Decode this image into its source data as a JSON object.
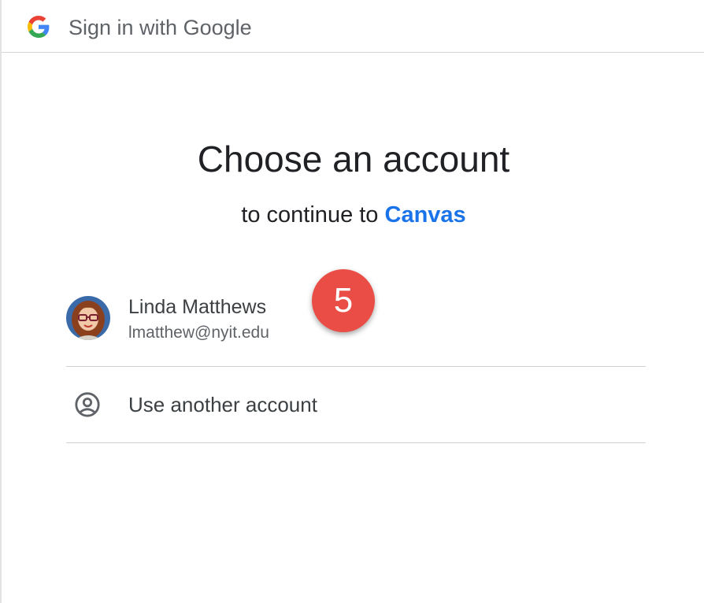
{
  "header": {
    "title": "Sign in with Google",
    "logo_icon": "google-g-icon"
  },
  "main": {
    "title": "Choose an account",
    "subtitle_prefix": "to continue to ",
    "subtitle_link": "Canvas",
    "link_color": "#1a73e8"
  },
  "accounts": [
    {
      "name": "Linda Matthews",
      "email": "lmatthew@nyit.edu",
      "avatar_icon": "user-avatar"
    }
  ],
  "badge": {
    "value": "5",
    "color": "#ea4d45"
  },
  "another_account": {
    "label": "Use another account",
    "icon": "account-circle-icon"
  }
}
